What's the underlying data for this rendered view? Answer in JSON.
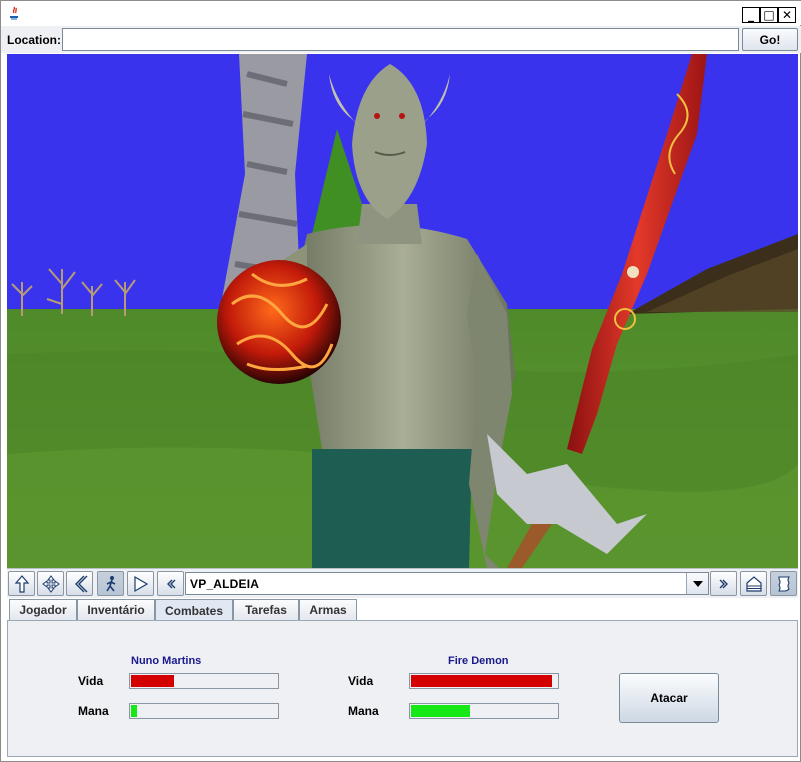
{
  "window": {
    "min": "_",
    "max": "□",
    "close": "✕"
  },
  "location": {
    "label": "Location:",
    "value": "",
    "go": "Go!"
  },
  "navbar": {
    "viewpoint": "VP_ALDEIA"
  },
  "tabs": [
    {
      "label": "Jogador"
    },
    {
      "label": "Inventário"
    },
    {
      "label": "Combates"
    },
    {
      "label": "Tarefas"
    },
    {
      "label": "Armas"
    }
  ],
  "selected_tab": "Combates",
  "combat": {
    "player": {
      "name": "Nuno Martins",
      "vida_label": "Vida",
      "mana_label": "Mana",
      "vida": 0.29,
      "mana": 0.04
    },
    "enemy": {
      "name": "Fire Demon",
      "vida_label": "Vida",
      "mana_label": "Mana",
      "vida": 0.95,
      "mana": 0.4
    },
    "attack_label": "Atacar"
  },
  "colors": {
    "vida": "#d40000",
    "mana": "#16e816",
    "name_text": "#1a1a8c"
  }
}
